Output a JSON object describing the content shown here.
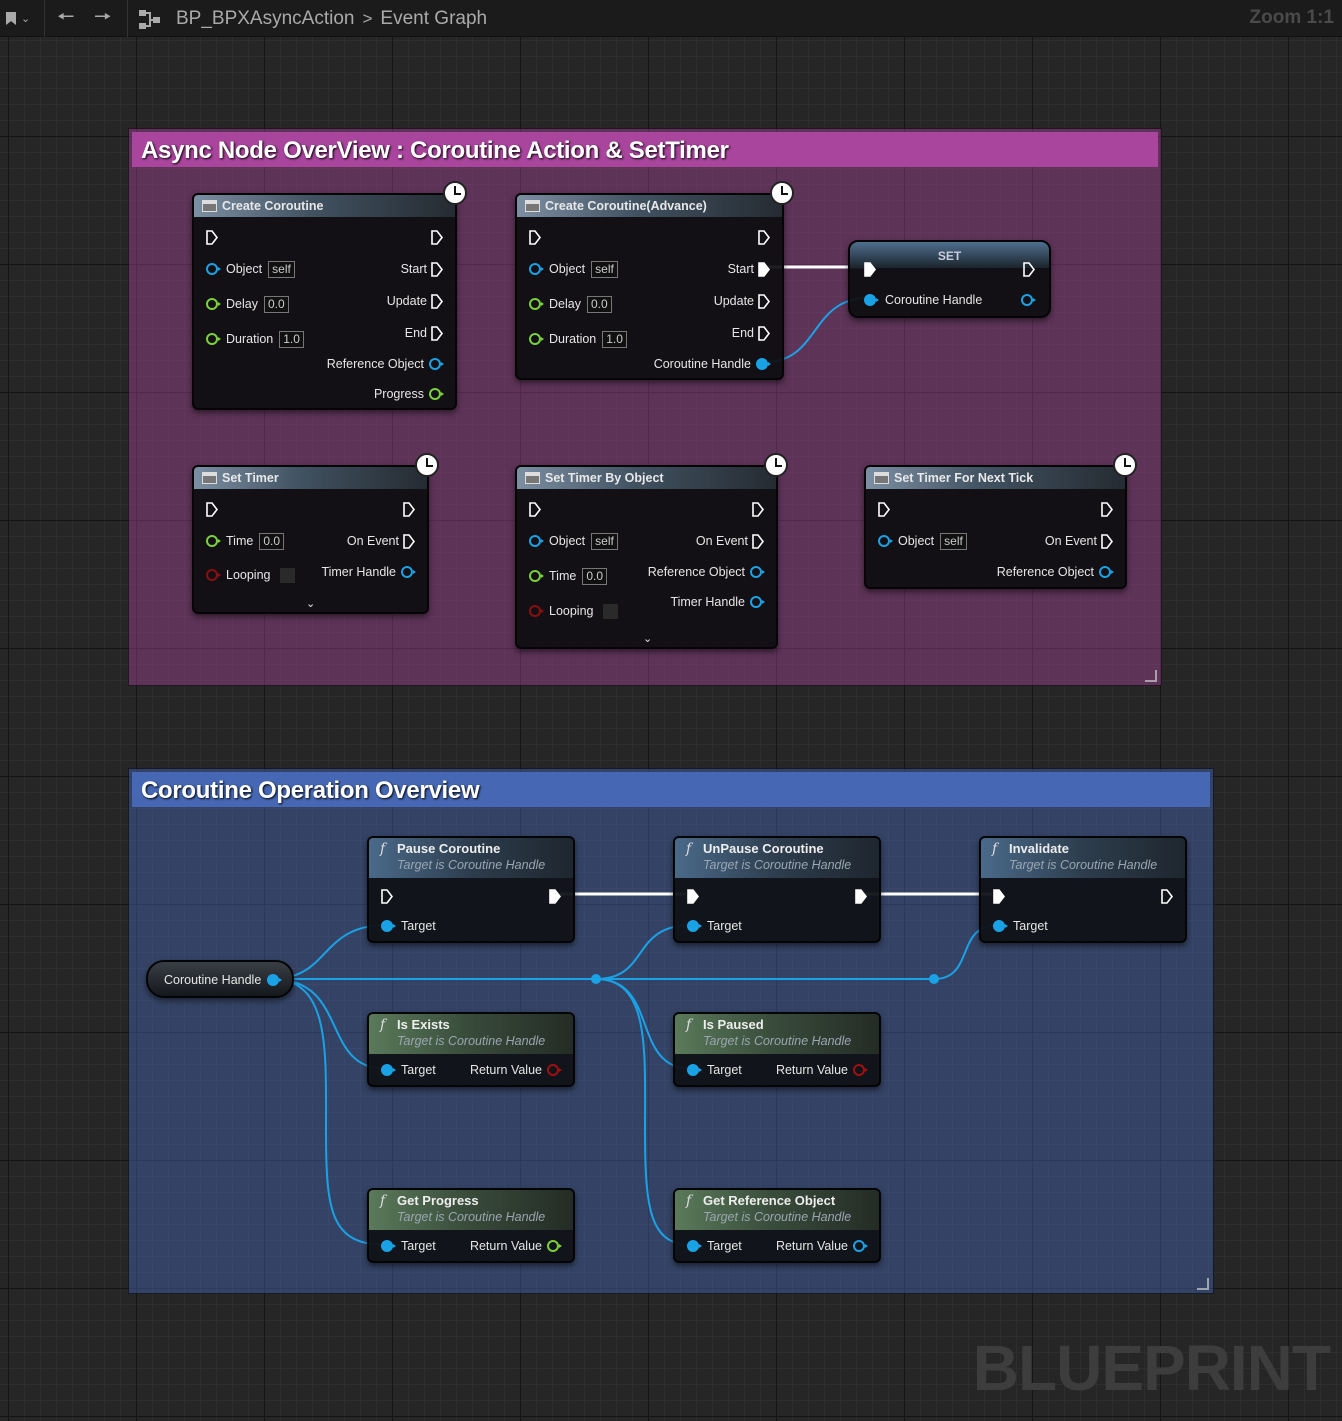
{
  "topbar": {
    "asset": "BP_BPXAsyncAction",
    "separator": ">",
    "graph": "Event Graph",
    "zoom": "Zoom 1:1"
  },
  "watermark": "BLUEPRINT",
  "comment1": {
    "title": "Async Node OverView : Coroutine Action & SetTimer",
    "color": "#a9459c"
  },
  "comment2": {
    "title": "Coroutine Operation Overview",
    "color": "#4668b4"
  },
  "nodes": {
    "create_coroutine": {
      "title": "Create Coroutine",
      "object": "Object",
      "object_val": "self",
      "delay": "Delay",
      "delay_val": "0.0",
      "duration": "Duration",
      "duration_val": "1.0",
      "start": "Start",
      "update": "Update",
      "end": "End",
      "ref": "Reference Object",
      "progress": "Progress"
    },
    "create_coroutine_adv": {
      "title": "Create Coroutine(Advance)",
      "object": "Object",
      "object_val": "self",
      "delay": "Delay",
      "delay_val": "0.0",
      "duration": "Duration",
      "duration_val": "1.0",
      "start": "Start",
      "update": "Update",
      "end": "End",
      "handle": "Coroutine Handle"
    },
    "set": {
      "title": "SET",
      "handle": "Coroutine Handle"
    },
    "set_timer": {
      "title": "Set Timer",
      "time": "Time",
      "time_val": "0.0",
      "looping": "Looping",
      "on_event": "On Event",
      "handle": "Timer Handle"
    },
    "set_timer_obj": {
      "title": "Set Timer By Object",
      "object": "Object",
      "object_val": "self",
      "time": "Time",
      "time_val": "0.0",
      "looping": "Looping",
      "on_event": "On Event",
      "ref": "Reference Object",
      "handle": "Timer Handle"
    },
    "set_timer_tick": {
      "title": "Set Timer For Next Tick",
      "object": "Object",
      "object_val": "self",
      "on_event": "On Event",
      "ref": "Reference Object"
    },
    "var_handle": {
      "label": "Coroutine Handle"
    },
    "pause": {
      "title": "Pause Coroutine",
      "sub": "Target is Coroutine Handle",
      "target": "Target"
    },
    "unpause": {
      "title": "UnPause Coroutine",
      "sub": "Target is Coroutine Handle",
      "target": "Target"
    },
    "invalidate": {
      "title": "Invalidate",
      "sub": "Target is Coroutine Handle",
      "target": "Target"
    },
    "is_exists": {
      "title": "Is Exists",
      "sub": "Target is Coroutine Handle",
      "target": "Target",
      "ret": "Return Value"
    },
    "is_paused": {
      "title": "Is Paused",
      "sub": "Target is Coroutine Handle",
      "target": "Target",
      "ret": "Return Value"
    },
    "get_progress": {
      "title": "Get Progress",
      "sub": "Target is Coroutine Handle",
      "target": "Target",
      "ret": "Return Value"
    },
    "get_ref": {
      "title": "Get Reference Object",
      "sub": "Target is Coroutine Handle",
      "target": "Target",
      "ret": "Return Value"
    }
  },
  "icons": [
    "bookmark-icon",
    "back-arrow-icon",
    "forward-arrow-icon",
    "blueprint-graph-icon",
    "clock-icon",
    "function-icon",
    "exec-pin-icon"
  ]
}
